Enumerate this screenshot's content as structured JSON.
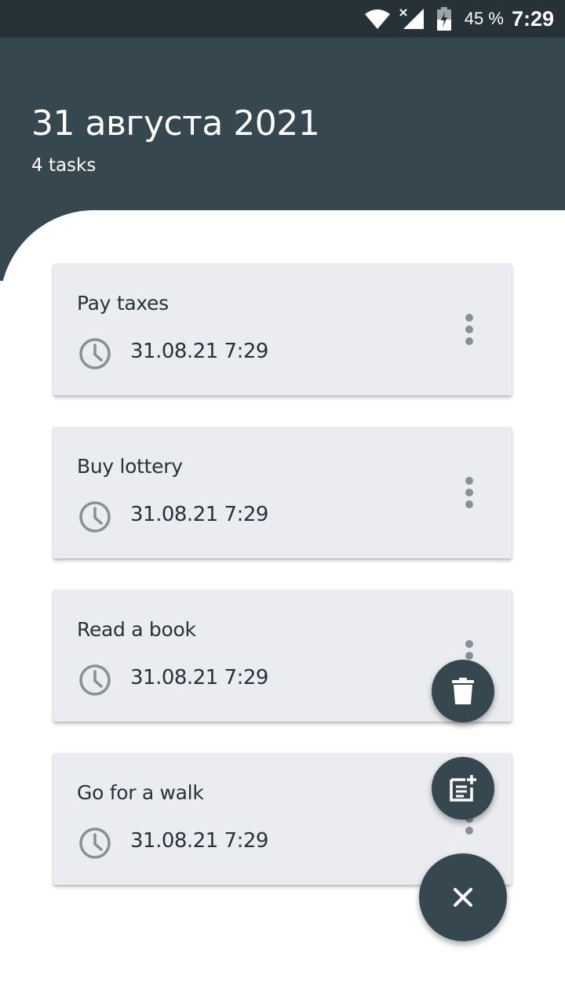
{
  "status_bar": {
    "battery_percent": "45 %",
    "time": "7:29",
    "icons": [
      "wifi-icon",
      "signal-icon",
      "battery-icon"
    ]
  },
  "header": {
    "title": "31 августа 2021",
    "subtitle": "4 tasks"
  },
  "tasks": [
    {
      "title": "Pay taxes",
      "time": "31.08.21 7:29"
    },
    {
      "title": "Buy lottery",
      "time": "31.08.21 7:29"
    },
    {
      "title": "Read a book",
      "time": "31.08.21 7:29"
    },
    {
      "title": "Go for a walk",
      "time": "31.08.21 7:29"
    }
  ],
  "fab_actions": {
    "delete_icon": "trash-icon",
    "add_icon": "note-add-icon",
    "close_icon": "close-icon"
  },
  "colors": {
    "status_bar": "#263238",
    "header": "#37474f",
    "card": "#eaecef",
    "fab": "#37474f",
    "text_dark": "#263238",
    "icon_gray": "#8a8f93"
  }
}
